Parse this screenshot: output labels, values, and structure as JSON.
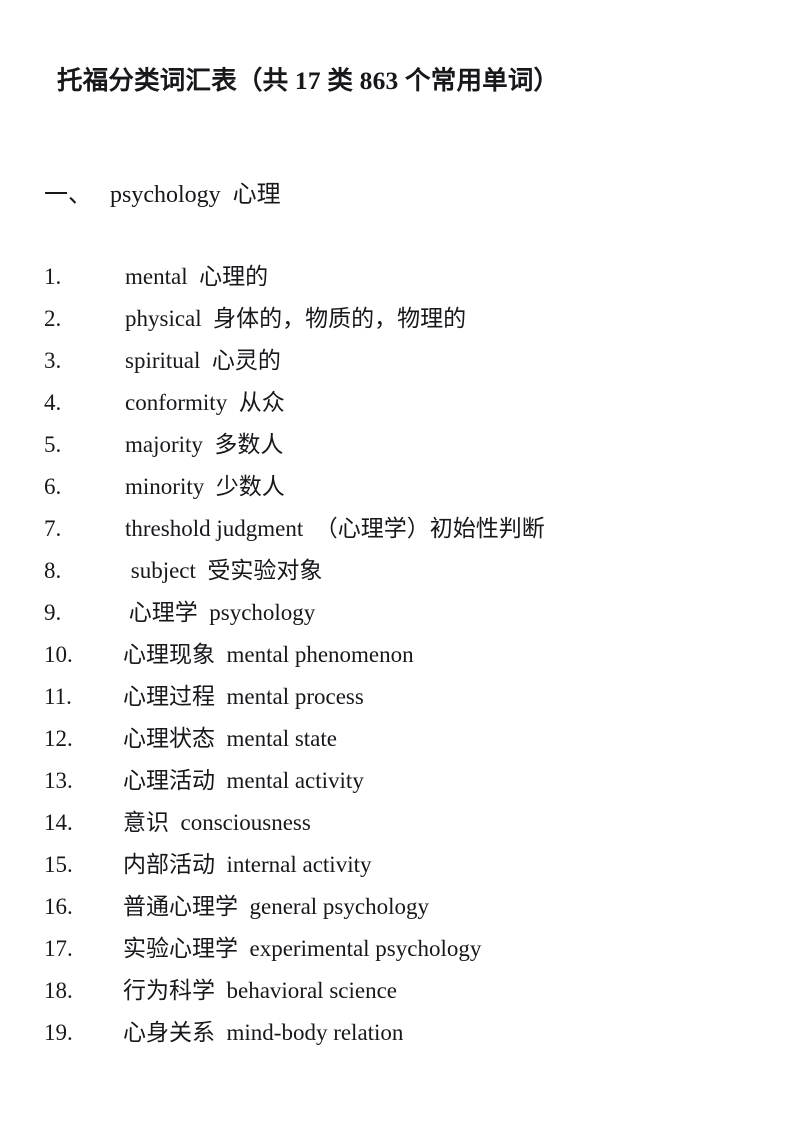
{
  "document": {
    "title": "托福分类词汇表（共 17 类 863 个常用单词）",
    "page_background": "#ffffff",
    "text_color": "#17171c"
  },
  "section": {
    "number": "一、",
    "name_en": "psychology",
    "name_zh": "心理",
    "heading_full": "一、　 psychology  心理"
  },
  "vocab_list": [
    {
      "num": "1.",
      "text": "mental  心理的",
      "lead": "latin"
    },
    {
      "num": "2.",
      "text": "physical  身体的，物质的，物理的",
      "lead": "latin"
    },
    {
      "num": "3.",
      "text": "spiritual  心灵的",
      "lead": "latin"
    },
    {
      "num": "4.",
      "text": "conformity  从众",
      "lead": "latin"
    },
    {
      "num": "5.",
      "text": "majority  多数人",
      "lead": "latin"
    },
    {
      "num": "6.",
      "text": "minority  少数人",
      "lead": "latin"
    },
    {
      "num": "7.",
      "text": "threshold judgment  （心理学）初始性判断",
      "lead": "latin"
    },
    {
      "num": "8.",
      "text": " subject  受实验对象",
      "lead": "latin"
    },
    {
      "num": "9.",
      "text": " 心理学  psychology",
      "lead": "cjk"
    },
    {
      "num": "10.",
      "text": "心理现象  mental phenomenon",
      "lead": "cjk"
    },
    {
      "num": "11.",
      "text": "心理过程  mental process",
      "lead": "cjk"
    },
    {
      "num": "12.",
      "text": "心理状态  mental state",
      "lead": "cjk"
    },
    {
      "num": "13.",
      "text": "心理活动  mental activity",
      "lead": "cjk"
    },
    {
      "num": "14.",
      "text": "意识  consciousness",
      "lead": "cjk"
    },
    {
      "num": "15.",
      "text": "内部活动  internal activity",
      "lead": "cjk"
    },
    {
      "num": "16.",
      "text": "普通心理学  general psychology",
      "lead": "cjk"
    },
    {
      "num": "17.",
      "text": "实验心理学  experimental psychology",
      "lead": "cjk"
    },
    {
      "num": "18.",
      "text": "行为科学  behavioral science",
      "lead": "cjk"
    },
    {
      "num": "19.",
      "text": "心身关系  mind-body relation",
      "lead": "cjk"
    }
  ]
}
